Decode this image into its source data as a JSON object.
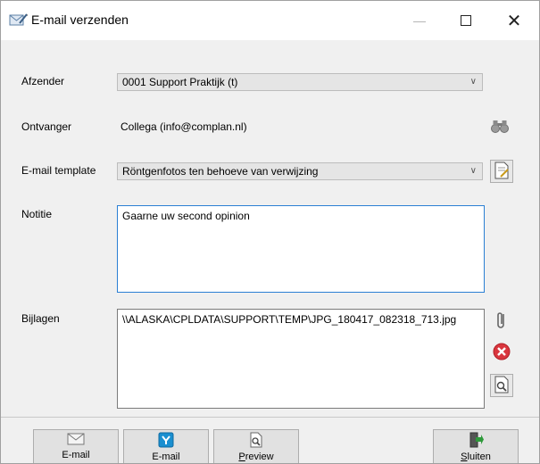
{
  "window": {
    "title": "E-mail verzenden",
    "controls": {
      "minimize": "—",
      "close": "✕"
    }
  },
  "form": {
    "sender_label": "Afzender",
    "sender_value": "0001 Support Praktijk (t)",
    "recipient_label": "Ontvanger",
    "recipient_value": "Collega (info@complan.nl)",
    "template_label": "E-mail template",
    "template_value": "Röntgenfotos ten behoeve van verwijzing",
    "note_label": "Notitie",
    "note_value": "Gaarne uw second opinion",
    "attachments_label": "Bijlagen",
    "attachments": [
      "\\\\ALASKA\\CPLDATA\\SUPPORT\\TEMP\\JPG_180417_082318_713.jpg"
    ]
  },
  "buttons": {
    "email_label": "E-mail",
    "secure_email_label": "E-mail",
    "preview_first": "P",
    "preview_rest": "review",
    "close_first": "S",
    "close_rest": "luiten"
  },
  "icons": {
    "title": "email-pencil-icon",
    "recipient_search": "binoculars-icon",
    "template_edit": "document-edit-icon",
    "attach": "paperclip-icon",
    "remove": "remove-x-icon",
    "view": "document-magnifier-icon"
  },
  "colors": {
    "focus_border": "#2a7fd4",
    "remove_red": "#d9363e",
    "secure_blue": "#1a8fd0",
    "door_green": "#2e9a3a"
  }
}
